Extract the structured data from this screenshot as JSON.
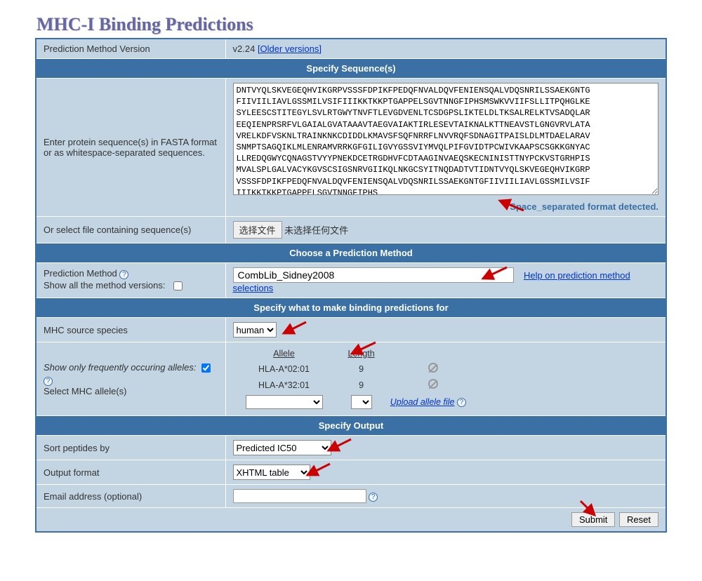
{
  "page_title": "MHC-I Binding Predictions",
  "version_row": {
    "label": "Prediction Method Version",
    "value": "v2.24",
    "older_link": "[Older versions]"
  },
  "sections": {
    "seq": "Specify Sequence(s)",
    "method": "Choose a Prediction Method",
    "binding": "Specify what to make binding predictions for",
    "output": "Specify Output"
  },
  "sequence": {
    "label": "Enter protein sequence(s) in FASTA format or as whitespace-separated sequences.",
    "text": "DNTVYQLSKVEGEQHVIKGRPVSSSFDPIKFPEDQFNVALDQVFENIENSQALVDQSNRILSSAEKGNTG\nFIIVIILIAVLGSSMILVSIFIIIKKTKKPTGAPPELSGVTNNGFIPHSMSWKVVIIFSLLITPQHGLKE\nSYLEESCSTITEGYLSVLRTGWYTNVFTLEVGDVENLTCSDGPSLIKTELDLTKSALRELKTVSADQLAR\nEEQIENPRSRFVLGAIALGVATAAAVTAEGVAIAKTIRLESEVTAIKNALKTTNEAVSTLGNGVRVLATA\nVRELKDFVSKNLTRAINKNKCDIDDLKMAVSFSQFNRRFLNVVRQFSDNAGITPAISLDLMTDAELARAV\nSNMPTSAGQIKLMLENRAMVRRKGFGILIGVYGSSVIYMVQLPIFGVIDTPCWIVKAAPSCSGKKGNYAC\nLLREDQGWYCQNAGSTVYYPNEKDCETRGDHVFCDTAAGINVAEQSKECNINISTTNYPCKVSTGRHPIS\nMVALSPLGALVACYKGVSCSIGSNRVGIIKQLNKGCSYITNQDADTVTIDNTVYQLSKVEGEQHVIKGRP\nVSSSFDPIKFPEDQFNVALDQVFENIENSQALVDQSNRILSSAEKGNTGFIIVIILIAVLGSSMILVSIF\nIIIKKTKKPTGAPPELSGVTNNGFIPHS",
    "detected": "Space_separated format detected."
  },
  "file_row": {
    "label": "Or select file containing sequence(s)",
    "button": "选择文件",
    "status": "未选择任何文件"
  },
  "method_row": {
    "label1": "Prediction Method",
    "label2": "Show all the method versions:",
    "value": "CombLib_Sidney2008",
    "help_link": "Help on prediction method selections"
  },
  "species_row": {
    "label": "MHC source species",
    "value": "human"
  },
  "allele_row": {
    "freq_label": "Show only frequently occuring alleles:",
    "select_label": "Select MHC allele(s)",
    "headers": {
      "allele": "Allele",
      "length": "Length"
    },
    "rows": [
      {
        "allele": "HLA-A*02:01",
        "length": "9"
      },
      {
        "allele": "HLA-A*32:01",
        "length": "9"
      }
    ],
    "upload_link": "Upload allele file"
  },
  "sort_row": {
    "label": "Sort peptides by",
    "value": "Predicted IC50"
  },
  "format_row": {
    "label": "Output format",
    "value": "XHTML table"
  },
  "email_row": {
    "label": "Email address (optional)"
  },
  "buttons": {
    "submit": "Submit",
    "reset": "Reset"
  }
}
